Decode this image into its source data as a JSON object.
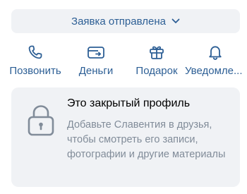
{
  "request": {
    "label": "Заявка отправлена"
  },
  "actions": [
    {
      "label": "Позвонить",
      "icon": "phone-icon"
    },
    {
      "label": "Деньги",
      "icon": "money-icon"
    },
    {
      "label": "Подарок",
      "icon": "gift-icon"
    },
    {
      "label": "Уведомле...",
      "icon": "bell-icon"
    }
  ],
  "private_profile": {
    "title": "Это закрытый профиль",
    "description": "Добавьте Славентия в друзья, чтобы смотреть его записи, фотографии и другие материалы",
    "icon": "lock-icon"
  },
  "colors": {
    "accent": "#2d5f95",
    "card_bg": "#f0f2f5",
    "secondary_text": "#818c99"
  }
}
